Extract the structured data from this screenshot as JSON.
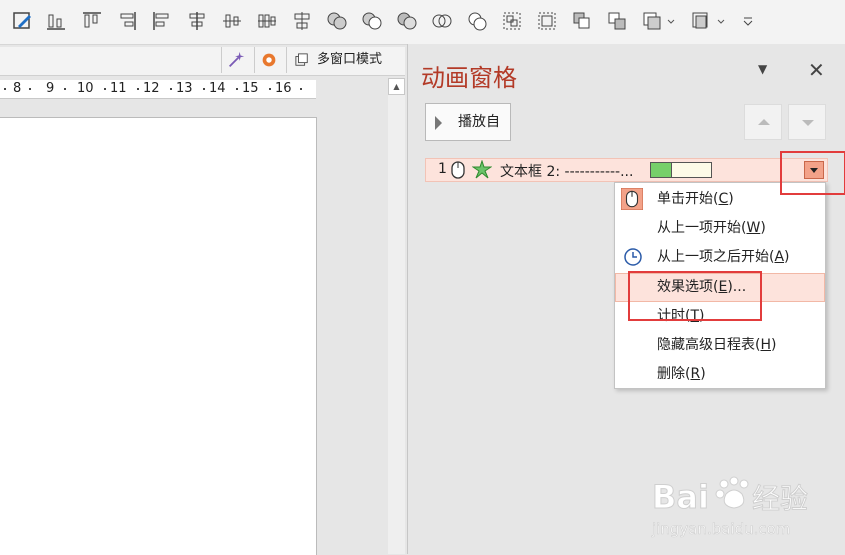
{
  "toolbar": {
    "icons": [
      "edit-shape-icon",
      "align-bottom-icon",
      "align-top-icon",
      "align-right-icon",
      "align-left-icon",
      "align-center-icon",
      "distribute-horizontal-icon",
      "distribute-vertical-icon",
      "align-middle-icon",
      "union-shape-icon",
      "combine-shape-icon",
      "fragment-shape-icon",
      "intersect-shape-icon",
      "subtract-shape-icon",
      "group-icon",
      "ungroup-icon",
      "bring-forward-icon",
      "send-backward-icon",
      "arrange-icon",
      "more-icon"
    ]
  },
  "doc": {
    "multi_window_label": "多窗口模式",
    "ruler_ticks": [
      "8",
      "9",
      "10",
      "11",
      "12",
      "13",
      "14",
      "15",
      "16"
    ]
  },
  "anim_pane": {
    "title": "动画窗格",
    "play_label": "播放自",
    "item": {
      "number": "1",
      "label": "文本框 2: -----------...",
      "timeline_fill": 0.33
    },
    "menu": [
      {
        "label": "单击开始",
        "key": "C"
      },
      {
        "label": "从上一项开始",
        "key": "W"
      },
      {
        "label": "从上一项之后开始",
        "key": "A"
      },
      {
        "label": "效果选项",
        "key": "E",
        "suffix": "..."
      },
      {
        "label": "计时",
        "key": "T"
      },
      {
        "label": "隐藏高级日程表",
        "key": "H"
      },
      {
        "label": "删除",
        "key": "R"
      }
    ]
  },
  "watermark": {
    "brand": "Bai",
    "brand2": "经验",
    "url": "jingyan.baidu.com"
  },
  "colors": {
    "title": "#b33a27",
    "highlight": "#e23c3c",
    "selected_bg": "#fde3dc"
  }
}
